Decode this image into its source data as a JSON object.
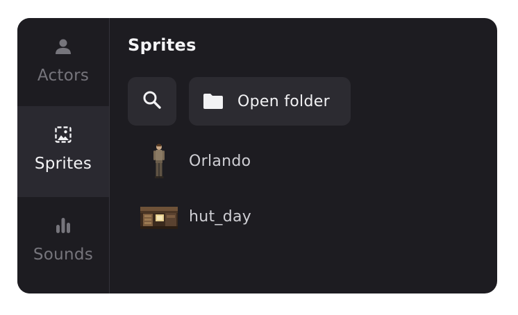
{
  "sidebar": {
    "items": [
      {
        "label": "Actors",
        "icon": "person-icon",
        "active": false
      },
      {
        "label": "Sprites",
        "icon": "image-icon",
        "active": true
      },
      {
        "label": "Sounds",
        "icon": "sound-bars-icon",
        "active": false
      }
    ]
  },
  "main": {
    "title": "Sprites",
    "search_icon": "search-icon",
    "open_folder_label": "Open folder",
    "open_folder_icon": "folder-icon",
    "sprites": [
      {
        "name": "Orlando",
        "thumbnail": "character-sprite"
      },
      {
        "name": "hut_day",
        "thumbnail": "background-sprite"
      }
    ]
  },
  "colors": {
    "panel_bg": "#1d1c21",
    "active_item_bg": "#2a2930",
    "button_bg": "#2c2b31",
    "text_primary": "#f3f3f5",
    "text_muted": "#76757c"
  }
}
